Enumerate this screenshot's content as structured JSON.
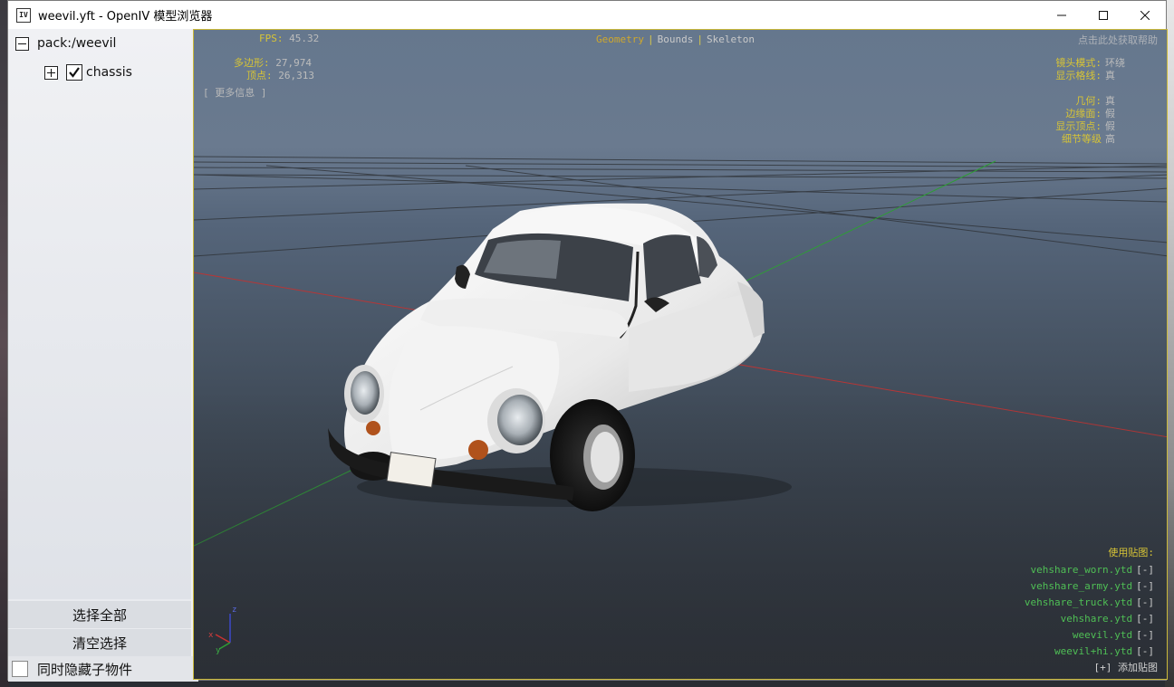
{
  "window": {
    "icon_text": "IV",
    "title": "weevil.yft - OpenIV 模型浏览器",
    "minimize_icon": "minimize-icon",
    "maximize_icon": "maximize-icon",
    "close_icon": "close-icon"
  },
  "tree": {
    "root": {
      "label": "pack:/weevil",
      "expanded": true
    },
    "children": [
      {
        "label": "chassis",
        "checked": true,
        "expanded": false
      }
    ]
  },
  "sidebar": {
    "select_all": "选择全部",
    "clear_selection": "清空选择",
    "hide_children": "同时隐藏子物件",
    "hide_children_checked": false
  },
  "viewport": {
    "fps_label": "FPS:",
    "fps_value": "45.32",
    "polygons_label": "多边形:",
    "polygons_value": "27,974",
    "vertices_label": "顶点:",
    "vertices_value": "26,313",
    "more_info": "[ 更多信息 ]",
    "tabs": [
      "Geometry",
      "Bounds",
      "Skeleton"
    ],
    "active_tab": "Geometry",
    "help": "点击此处获取帮助",
    "camera_label": "镜头模式:",
    "camera_value": "环绕",
    "grid_label": "显示格线:",
    "grid_value": "真",
    "geometry_label": "几何:",
    "geometry_value": "真",
    "edges_label": "边缘面:",
    "edges_value": "假",
    "show_vertices_label": "显示顶点:",
    "show_vertices_value": "假",
    "lod_label": "细节等级",
    "lod_value": "高",
    "textures_title": "使用贴图:",
    "textures": [
      "vehshare_worn.ytd",
      "vehshare_army.ytd",
      "vehshare_truck.ytd",
      "vehshare.ytd",
      "weevil.ytd",
      "weevil+hi.ytd"
    ],
    "remove_label": "[-]",
    "add_texture": "[+] 添加贴图",
    "axis_labels": {
      "x": "x",
      "y": "y",
      "z": "z"
    }
  },
  "colors": {
    "hud_yellow": "#d7c436",
    "texture_green": "#4fbf55",
    "axis_red": "#c83232",
    "axis_green": "#2e9e35",
    "car_body": "#f2f2f2"
  }
}
